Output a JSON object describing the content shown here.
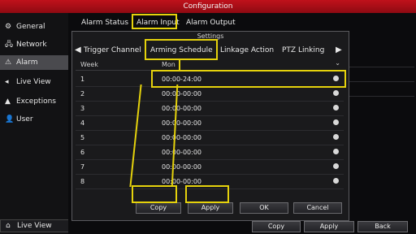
{
  "window": {
    "title": "Configuration"
  },
  "sidebar": {
    "items": [
      {
        "label": "General",
        "icon": "gear-icon",
        "glyph": "⚙"
      },
      {
        "label": "Network",
        "icon": "network-icon",
        "glyph": "🖧"
      },
      {
        "label": "Alarm",
        "icon": "alarm-icon",
        "glyph": "⚠"
      },
      {
        "label": "Live View",
        "icon": "live-view-icon",
        "glyph": "◂"
      },
      {
        "label": "Exceptions",
        "icon": "exceptions-icon",
        "glyph": "▲"
      },
      {
        "label": "User",
        "icon": "user-icon",
        "glyph": "👤"
      }
    ],
    "bottom": {
      "label": "Live View",
      "icon": "home-icon",
      "glyph": "⌂"
    }
  },
  "tabs": [
    "Alarm Status",
    "Alarm Input",
    "Alarm Output"
  ],
  "dialog": {
    "title": "Settings",
    "subtabs": [
      "Trigger Channel",
      "Arming Schedule",
      "Linkage Action",
      "PTZ Linking"
    ],
    "columns": {
      "week": "Week",
      "day": "Mon"
    },
    "rows": [
      {
        "num": "1",
        "time": "00:00-24:00"
      },
      {
        "num": "2",
        "time": "00:00-00:00"
      },
      {
        "num": "3",
        "time": "00:00-00:00"
      },
      {
        "num": "4",
        "time": "00:00-00:00"
      },
      {
        "num": "5",
        "time": "00:00-00:00"
      },
      {
        "num": "6",
        "time": "00:00-00:00"
      },
      {
        "num": "7",
        "time": "00:00-00:00"
      },
      {
        "num": "8",
        "time": "00:00-00:00"
      }
    ],
    "buttons": {
      "copy": "Copy",
      "apply": "Apply",
      "ok": "OK",
      "cancel": "Cancel"
    }
  },
  "footer": {
    "copy": "Copy",
    "apply": "Apply",
    "back": "Back"
  },
  "colors": {
    "titlebar": "#b00f18",
    "highlight": "#e5d20c"
  }
}
